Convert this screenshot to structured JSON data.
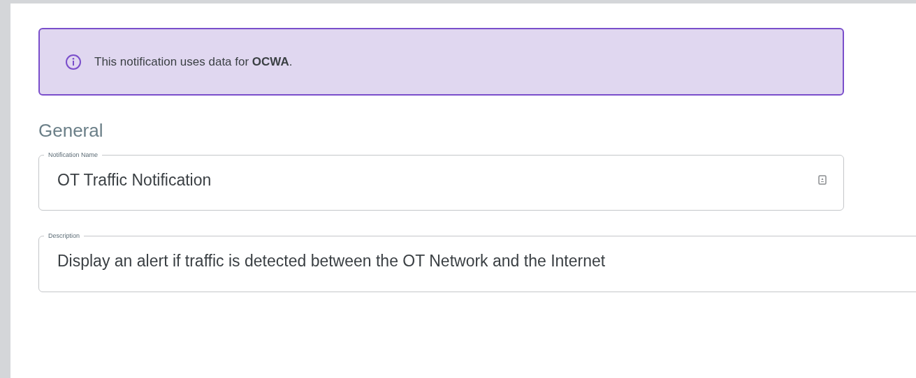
{
  "banner": {
    "text": "This notification uses data for **OCWA**."
  },
  "section": {
    "title": "General"
  },
  "fields": [
    {
      "kind": "autofill",
      "label": "Notification Name",
      "value": "OT Traffic Notification"
    },
    {
      "kind": "plain",
      "label": "Description",
      "value": "Display an alert if traffic is detected between the OT Network and the Internet"
    }
  ]
}
